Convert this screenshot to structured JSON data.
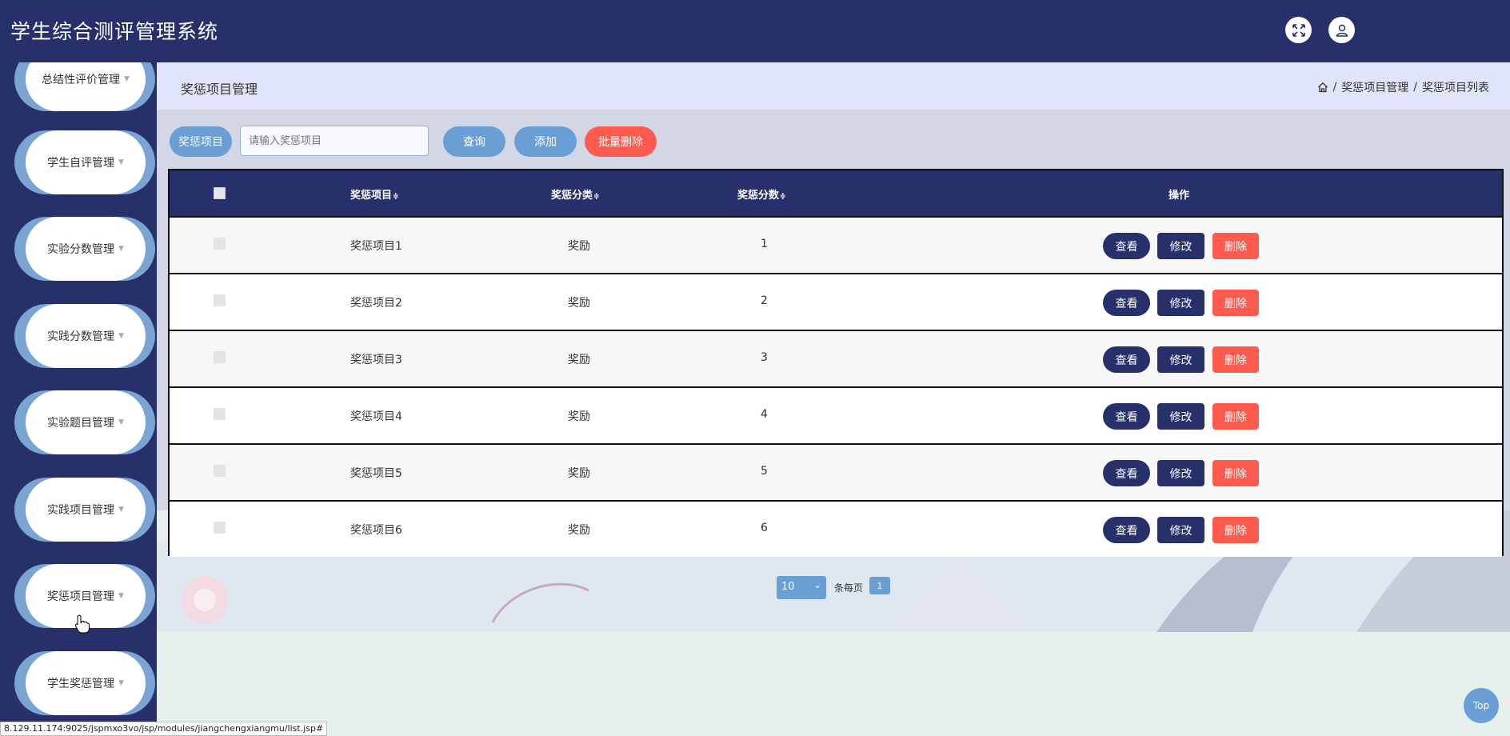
{
  "app": {
    "title": "学生综合测评管理系统"
  },
  "header": {
    "fullscreen_icon": "expand-arrows-icon",
    "user_icon": "user-icon"
  },
  "sidebar": {
    "items": [
      {
        "label": "总结性评价管理"
      },
      {
        "label": "学生自评管理"
      },
      {
        "label": "实验分数管理"
      },
      {
        "label": "实践分数管理"
      },
      {
        "label": "实验题目管理"
      },
      {
        "label": "实践项目管理"
      },
      {
        "label": "奖惩项目管理"
      },
      {
        "label": "学生奖惩管理"
      }
    ]
  },
  "breadcrumb": {
    "title": "奖惩项目管理",
    "home_icon": "home-icon",
    "items": [
      "奖惩项目管理",
      "奖惩项目列表"
    ],
    "separator": "/"
  },
  "search": {
    "label": "奖惩项目",
    "placeholder": "请输入奖惩项目",
    "query_label": "查询",
    "add_label": "添加",
    "batch_delete_label": "批量删除"
  },
  "table": {
    "columns": [
      "奖惩项目",
      "奖惩分类",
      "奖惩分数",
      "操作"
    ],
    "sort_icon": "≑",
    "rows": [
      {
        "name": "奖惩项目1",
        "category": "奖励",
        "score": "1"
      },
      {
        "name": "奖惩项目2",
        "category": "奖励",
        "score": "2"
      },
      {
        "name": "奖惩项目3",
        "category": "奖励",
        "score": "3"
      },
      {
        "name": "奖惩项目4",
        "category": "奖励",
        "score": "4"
      },
      {
        "name": "奖惩项目5",
        "category": "奖励",
        "score": "5"
      },
      {
        "name": "奖惩项目6",
        "category": "奖励",
        "score": "6"
      }
    ],
    "actions": {
      "view": "查看",
      "edit": "修改",
      "delete": "删除"
    }
  },
  "pagination": {
    "page_size": "10",
    "page_size_options": [
      "10"
    ],
    "per_page_label": "条每页",
    "current_page": "1"
  },
  "status_bar": {
    "url": "8.129.11.174:9025/jspmxo3vo/jsp/modules/jiangchengxiangmu/list.jsp#"
  },
  "back_to_top": {
    "label": "Top"
  },
  "colors": {
    "primary": "#27306b",
    "light_blue": "#6a9fd6",
    "danger": "#ff5a4e",
    "header_bg": "#e0e5fb"
  }
}
